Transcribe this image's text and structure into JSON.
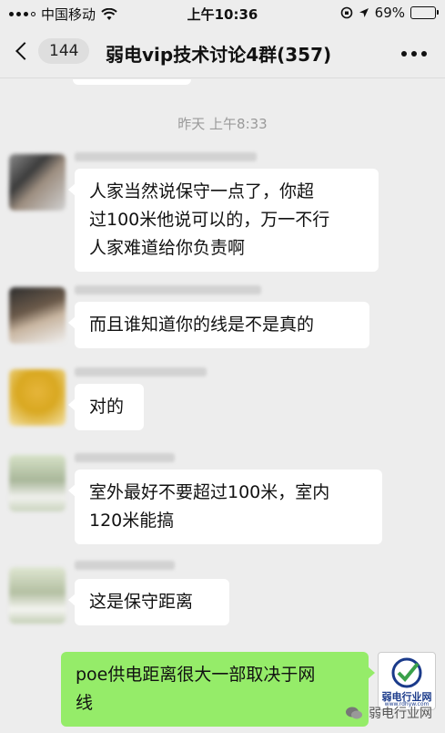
{
  "status_bar": {
    "carrier": "中国移动",
    "time": "上午10:36",
    "battery_percent": "69%",
    "battery_level": 0.69
  },
  "nav": {
    "unread_count": "144",
    "title": "弱电vip技术讨论4群(357)"
  },
  "chat": {
    "timestamp": "昨天 上午8:33",
    "messages": [
      {
        "text": "人家当然说保守一点了，你超\n过100米他说可以的，万一不行\n人家难道给你负责啊"
      },
      {
        "text": "而且谁知道你的线是不是真的"
      },
      {
        "text": "对的"
      },
      {
        "text": "室外最好不要超过100米，室内\n120米能搞"
      },
      {
        "text": "这是保守距离"
      }
    ],
    "self_message": {
      "text": "poe供电距离很大一部取决于网\n线"
    }
  },
  "self_avatar": {
    "logo_text": "弱电行业网",
    "logo_sub": "www.rdhyw.com"
  },
  "watermark": {
    "text": "弱电行业网",
    "icon": "wechat-icon"
  },
  "colors": {
    "self_bubble": "#95ec69",
    "background": "#ededed"
  }
}
